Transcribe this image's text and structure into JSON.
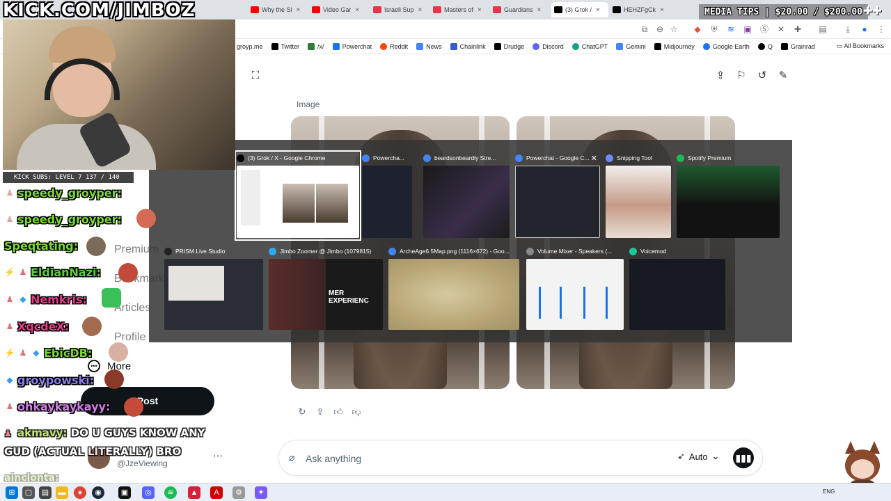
{
  "browser": {
    "tabs": [
      {
        "label": "Why the Sl",
        "color": "#ff0000"
      },
      {
        "label": "Video Gar",
        "color": "#ff0000"
      },
      {
        "label": "Israeli Sup",
        "color": "#e8334b"
      },
      {
        "label": "Masters of",
        "color": "#e8334b"
      },
      {
        "label": "Guardians",
        "color": "#e8334b"
      },
      {
        "label": "(3) Grok /",
        "color": "#000000",
        "active": true
      },
      {
        "label": "HEHZFgCk",
        "color": "#000000"
      }
    ],
    "bookmarks": [
      {
        "label": "groyp.me",
        "color": "#9aa0a6"
      },
      {
        "label": "Twitter",
        "color": "#000000"
      },
      {
        "label": "/x/",
        "color": "#2e7d32"
      },
      {
        "label": "Powerchat",
        "color": "#1a73e8"
      },
      {
        "label": "Reddit",
        "color": "#ff4500"
      },
      {
        "label": "News",
        "color": "#4285f4"
      },
      {
        "label": "Chainlink",
        "color": "#375bd2"
      },
      {
        "label": "Drudge",
        "color": "#000000"
      },
      {
        "label": "Discord",
        "color": "#5865f2"
      },
      {
        "label": "ChatGPT",
        "color": "#10a37f"
      },
      {
        "label": "Gemini",
        "color": "#4285f4"
      },
      {
        "label": "Midjourney",
        "color": "#000000"
      },
      {
        "label": "Google Earth",
        "color": "#1a73e8"
      },
      {
        "label": "Q",
        "color": "#000000"
      },
      {
        "label": "Grainrad",
        "color": "#000000"
      }
    ],
    "all_bookmarks": "All Bookmarks"
  },
  "grok": {
    "image_label": "Image",
    "ask_placeholder": "Ask anything",
    "mode": "Auto",
    "header_icons": [
      "expand-icon",
      "share-icon",
      "bookmark-icon",
      "history-icon",
      "edit-icon"
    ],
    "action_icons": [
      "regenerate-icon",
      "share-icon",
      "thumbs-up-icon",
      "thumbs-down-icon"
    ]
  },
  "x_nav": {
    "premium": "Premium",
    "bookmarks": "Bookmarks",
    "articles": "Articles",
    "profile": "Profile",
    "more": "More",
    "post": "Post",
    "handle": "@JzeViewing"
  },
  "switcher": {
    "row1": [
      {
        "title": "(3) Grok / X - Google Chrome",
        "icon_color": "#000000",
        "selected": true
      },
      {
        "title": "Powercha...",
        "icon_color": "#4285f4"
      },
      {
        "title": "beardsonbeardly Stre...",
        "icon_color": "#4285f4"
      },
      {
        "title": "Powerchat - Google C...",
        "icon_color": "#4285f4",
        "closable": true
      },
      {
        "title": "Snipping Tool",
        "icon_color": "#6b8cff"
      },
      {
        "title": "Spotify Premium",
        "icon_color": "#1db954"
      }
    ],
    "row2": [
      {
        "title": "PRISM Live Studio",
        "icon_color": "#222222"
      },
      {
        "title": "Jimbo Zoomer @ Jimbo (1079815)",
        "icon_color": "#2aabee"
      },
      {
        "title": "ArcheAge6.5Map.png (1116×672) - Goo...",
        "icon_color": "#4285f4"
      },
      {
        "title": "Volume Mixer - Speakers (...",
        "icon_color": "#888888"
      },
      {
        "title": "Voicemod",
        "icon_color": "#18c99b"
      }
    ],
    "thumb_text": "MER EXPERIENC"
  },
  "overlay": {
    "stream_title": "KICK.COM/JIMBOZ",
    "media_tips": "MEDIA TIPS | $20.00 / $200.00",
    "subs_bar": "KICK SUBS: LEVEL 7 137 / 140",
    "chat": [
      {
        "name": "speedy_groyper:",
        "color": "#7ad83a",
        "badges": ""
      },
      {
        "name": "speedy_groyper:",
        "color": "#7ad83a",
        "badges": ""
      },
      {
        "name": "Speqtating:",
        "color": "#7ad83a",
        "badges": ""
      },
      {
        "name": "EldianNazi:",
        "color": "#5bd23a",
        "badges": "⚡♟"
      },
      {
        "name": "Nemkris:",
        "color": "#e53a8a",
        "badges": "♟◆"
      },
      {
        "name": "XqcdeX:",
        "color": "#e53a8a",
        "badges": "♟"
      },
      {
        "name": "EbicDB:",
        "color": "#7ad83a",
        "badges": "⚡♟◆"
      },
      {
        "name": "groypowski:",
        "color": "#8a7ee8",
        "badges": "◆"
      },
      {
        "name": "ohkaykaykayy:",
        "color": "#d37ee8",
        "badges": "♟"
      }
    ],
    "last_message": {
      "name": "akmavy:",
      "text": "DO U GUYS KNOW ANY GUD (ACTUAL LITERALLY) BRO"
    },
    "faded_chat": "ainclonta:"
  },
  "taskbar": {
    "lang": "ENG",
    "apps": [
      {
        "name": "windows-icon",
        "color": "#0078d4"
      },
      {
        "name": "search-icon",
        "color": "#444444"
      },
      {
        "name": "task-view-icon",
        "color": "#444444"
      },
      {
        "name": "file-explorer-icon",
        "color": "#f2b81b"
      },
      {
        "name": "chrome-icon",
        "color": "#db4437"
      },
      {
        "name": "steam-icon",
        "color": "#1b2838"
      },
      {
        "name": "terminal-icon",
        "color": "#111111"
      },
      {
        "name": "discord-icon",
        "color": "#5865f2"
      },
      {
        "name": "app-icon",
        "color": "#222222"
      },
      {
        "name": "spotify-icon",
        "color": "#1db954"
      },
      {
        "name": "app-red-icon",
        "color": "#d81e3a"
      },
      {
        "name": "adobe-icon",
        "color": "#cc0000"
      },
      {
        "name": "settings-icon",
        "color": "#999999"
      },
      {
        "name": "app-purple-icon",
        "color": "#7a5af8"
      }
    ]
  }
}
